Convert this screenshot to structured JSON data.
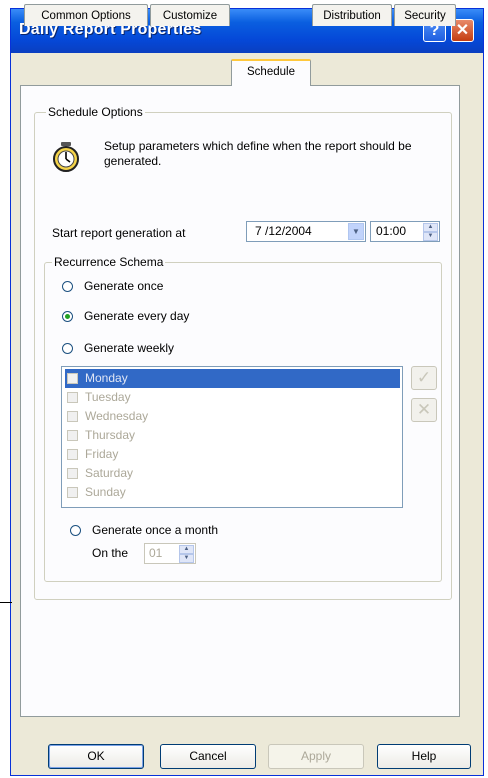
{
  "window": {
    "title": "Daily Report Properties",
    "help_glyph": "?",
    "close_glyph": "✕"
  },
  "tabs": [
    "Common Options",
    "Customize",
    "Schedule",
    "Distribution",
    "Security"
  ],
  "schedule": {
    "group_label": "Schedule Options",
    "description": "Setup parameters which define when the report should be generated.",
    "start_label": "Start report generation at",
    "start_date": "7 /12/2004",
    "start_time": "01:00"
  },
  "recurrence": {
    "group_label": "Recurrence Schema",
    "options": [
      "Generate once",
      "Generate every day",
      "Generate weekly"
    ],
    "selected": "Generate every day",
    "days": [
      "Monday",
      "Tuesday",
      "Wednesday",
      "Thursday",
      "Friday",
      "Saturday",
      "Sunday"
    ],
    "monthly_label": "Generate once a month",
    "on_the_label": "On the",
    "day_of_month": "01"
  },
  "buttons": {
    "ok": "OK",
    "cancel": "Cancel",
    "apply": "Apply",
    "help": "Help"
  }
}
